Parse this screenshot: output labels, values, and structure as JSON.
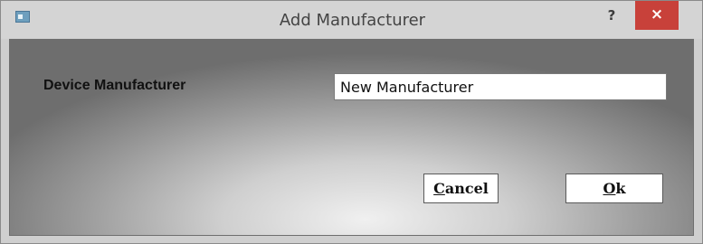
{
  "window": {
    "title": "Add Manufacturer",
    "help_label": "?",
    "close_label": "×"
  },
  "form": {
    "label": "Device Manufacturer",
    "manufacturer_value": "New Manufacturer"
  },
  "buttons": {
    "cancel_first": "C",
    "cancel_rest": "ancel",
    "ok_first": "O",
    "ok_rest": "k"
  },
  "colors": {
    "close_button": "#c8413a",
    "titlebar": "#d4d4d4"
  }
}
